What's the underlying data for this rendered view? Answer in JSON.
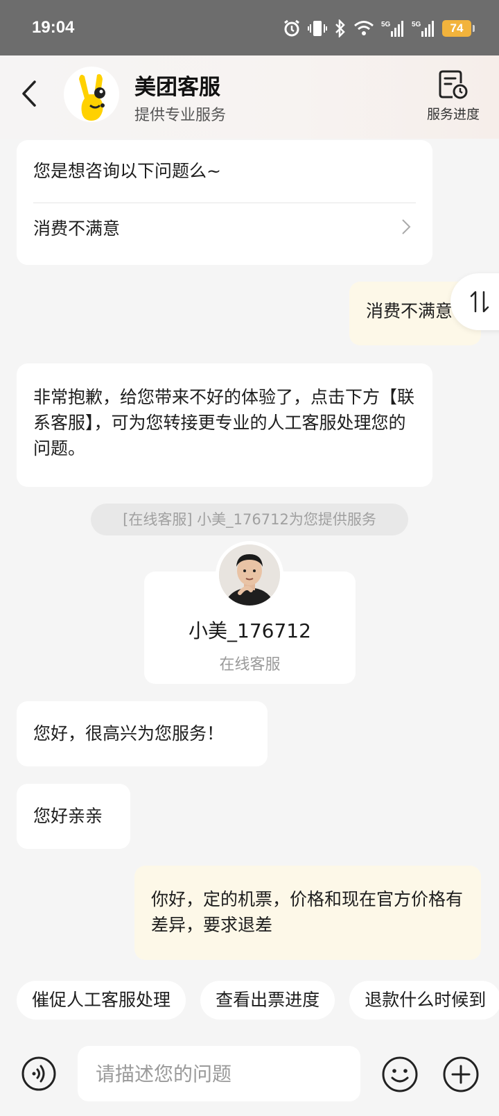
{
  "status_bar": {
    "time": "19:04",
    "battery": "74",
    "icons": [
      "alarm-icon",
      "vibrate-icon",
      "bluetooth-icon",
      "wifi-icon",
      "signal-5g-icon",
      "signal-5g-icon"
    ]
  },
  "header": {
    "title": "美团客服",
    "subtitle": "提供专业服务",
    "progress_label": "服务进度"
  },
  "messages": {
    "question_card": {
      "title": "您是想咨询以下问题么~",
      "item": "消费不满意"
    },
    "user_1": "消费不满意",
    "bot_reply": "非常抱歉，给您带来不好的体验了，点击下方【联系客服】，可为您转接更专业的人工客服处理您的问题。",
    "system_notice": "[在线客服] 小美_176712为您提供服务",
    "agent_card": {
      "name": "小美_176712",
      "role": "在线客服"
    },
    "agent_1": "您好，很高兴为您服务！",
    "agent_2": "您好亲亲",
    "user_2": "你好，定的机票，价格和现在官方价格有差异，要求退差"
  },
  "quick_replies": [
    "催促人工客服处理",
    "查看出票进度",
    "退款什么时候到"
  ],
  "input": {
    "placeholder": "请描述您的问题"
  },
  "colors": {
    "brand_yellow": "#ffd100",
    "user_bubble": "#fdf8e8",
    "background": "#f5f5f5"
  }
}
